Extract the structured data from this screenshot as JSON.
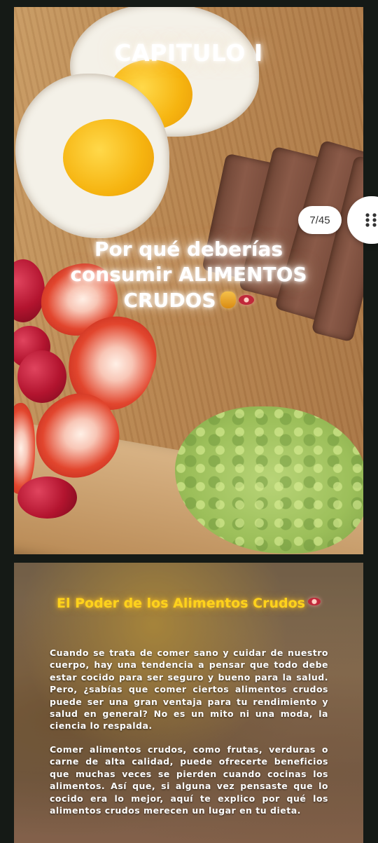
{
  "slide1": {
    "chapter": "CAPITULO I",
    "headline": "Por qué deberías consumir ALIMENTOS CRUDOS"
  },
  "viewer": {
    "page_counter": "7/45",
    "grid_icon": "grid-dots-icon"
  },
  "slide2": {
    "title": "El Poder de los Alimentos Crudos",
    "paragraph1": "Cuando se trata de comer sano y cuidar de nuestro cuerpo, hay una tendencia a pensar que todo debe estar cocido para ser seguro y bueno para la salud. Pero, ¿sabías que comer ciertos alimentos crudos puede ser una gran ventaja para tu rendimiento y salud en general? No es un mito ni una moda, la ciencia lo respalda.",
    "paragraph2": "Comer alimentos crudos, como frutas, verduras o carne de alta calidad, puede ofrecerte beneficios que muchas veces se pierden cuando cocinas los alimentos. Así que, si alguna vez pensaste que lo cocido era lo mejor, aquí te explico por qué los alimentos crudos merecen un lugar en tu dieta."
  },
  "colors": {
    "background": "#151a16",
    "title_yellow": "#ffd21c",
    "text_white": "#ffffff"
  }
}
